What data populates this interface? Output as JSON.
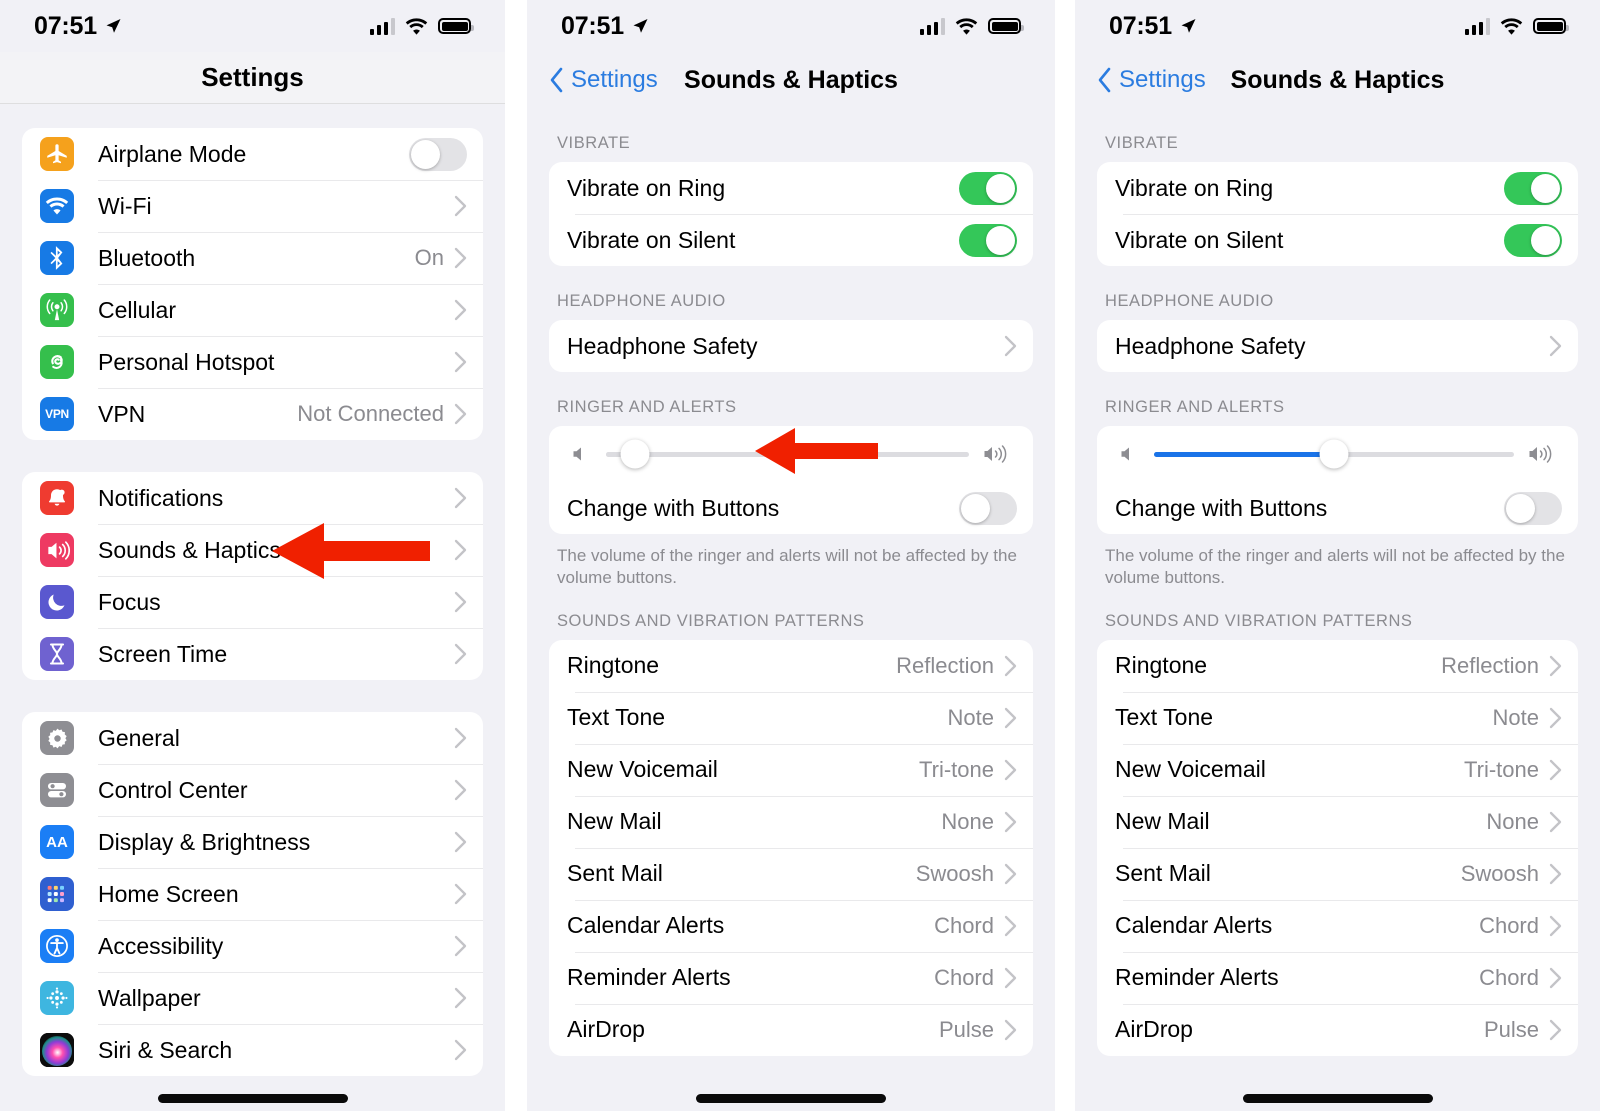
{
  "status_bar": {
    "time": "07:51",
    "location_icon": "location-arrow-icon",
    "signal_icon": "cellular-signal-icon",
    "wifi_icon": "wifi-icon",
    "battery_icon": "battery-icon"
  },
  "panel1": {
    "nav_title": "Settings",
    "groups": [
      {
        "rows": [
          {
            "icon": "airplane-icon",
            "label": "Airplane Mode",
            "accessory": "toggle",
            "toggle_on": false
          },
          {
            "icon": "wifi-icon",
            "label": "Wi-Fi",
            "value": "",
            "accessory": "chevron"
          },
          {
            "icon": "bluetooth-icon",
            "label": "Bluetooth",
            "value": "On",
            "accessory": "chevron"
          },
          {
            "icon": "cellular-icon",
            "label": "Cellular",
            "value": "",
            "accessory": "chevron"
          },
          {
            "icon": "personal-hotspot-icon",
            "label": "Personal Hotspot",
            "value": "",
            "accessory": "chevron"
          },
          {
            "icon": "vpn-icon",
            "label": "VPN",
            "value": "Not Connected",
            "accessory": "chevron"
          }
        ]
      },
      {
        "rows": [
          {
            "icon": "notifications-bell-icon",
            "label": "Notifications",
            "value": "",
            "accessory": "chevron"
          },
          {
            "icon": "sounds-haptics-speaker-icon",
            "label": "Sounds & Haptics",
            "value": "",
            "accessory": "chevron"
          },
          {
            "icon": "focus-moon-icon",
            "label": "Focus",
            "value": "",
            "accessory": "chevron"
          },
          {
            "icon": "screen-time-hourglass-icon",
            "label": "Screen Time",
            "value": "",
            "accessory": "chevron"
          }
        ]
      },
      {
        "rows": [
          {
            "icon": "general-gear-icon",
            "label": "General",
            "value": "",
            "accessory": "chevron"
          },
          {
            "icon": "control-center-icon",
            "label": "Control Center",
            "value": "",
            "accessory": "chevron"
          },
          {
            "icon": "display-brightness-aa-icon",
            "label": "Display & Brightness",
            "value": "",
            "accessory": "chevron"
          },
          {
            "icon": "home-screen-grid-icon",
            "label": "Home Screen",
            "value": "",
            "accessory": "chevron"
          },
          {
            "icon": "accessibility-icon",
            "label": "Accessibility",
            "value": "",
            "accessory": "chevron"
          },
          {
            "icon": "wallpaper-icon",
            "label": "Wallpaper",
            "value": "",
            "accessory": "chevron"
          },
          {
            "icon": "siri-search-icon",
            "label": "Siri & Search",
            "value": "",
            "accessory": "chevron"
          }
        ]
      }
    ]
  },
  "sounds_page": {
    "back_label": "Settings",
    "nav_title": "Sounds & Haptics",
    "sections": {
      "vibrate_header": "VIBRATE",
      "vibrate_rows": [
        {
          "label": "Vibrate on Ring",
          "toggle_on": true
        },
        {
          "label": "Vibrate on Silent",
          "toggle_on": true
        }
      ],
      "headphone_header": "HEADPHONE AUDIO",
      "headphone_row": {
        "label": "Headphone Safety"
      },
      "ringer_header": "RINGER AND ALERTS",
      "ringer_slider": {
        "low_icon": "speaker-low-icon",
        "high_icon": "speaker-high-icon"
      },
      "change_with_buttons": {
        "label": "Change with Buttons",
        "toggle_on": false
      },
      "footnote": "The volume of the ringer and alerts will not be affected by the volume buttons.",
      "patterns_header": "SOUNDS AND VIBRATION PATTERNS",
      "pattern_rows": [
        {
          "label": "Ringtone",
          "value": "Reflection"
        },
        {
          "label": "Text Tone",
          "value": "Note"
        },
        {
          "label": "New Voicemail",
          "value": "Tri-tone"
        },
        {
          "label": "New Mail",
          "value": "None"
        },
        {
          "label": "Sent Mail",
          "value": "Swoosh"
        },
        {
          "label": "Calendar Alerts",
          "value": "Chord"
        },
        {
          "label": "Reminder Alerts",
          "value": "Chord"
        },
        {
          "label": "AirDrop",
          "value": "Pulse"
        }
      ]
    }
  },
  "panel2": {
    "ringer_volume_percent": 8
  },
  "panel3": {
    "ringer_volume_percent": 50
  },
  "annotations": {
    "arrow_color": "#f02000",
    "arrow1_name": "arrow-pointing-to-sounds-haptics",
    "arrow2_name": "arrow-pointing-to-ringer-and-alerts",
    "arrow3_name": "arrow-pointing-down-to-volume-slider"
  }
}
